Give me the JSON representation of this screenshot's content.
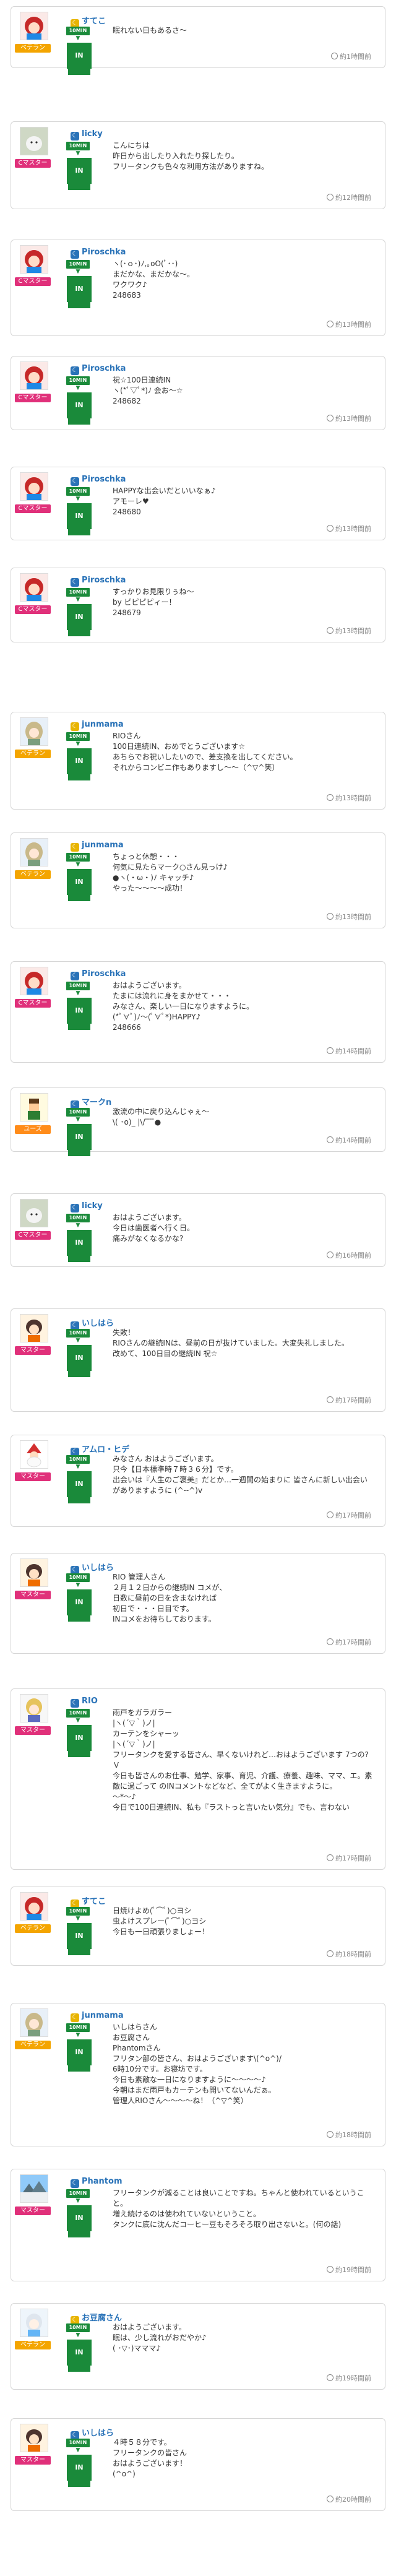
{
  "colors": {
    "veteran": "#f4a500",
    "master": "#e0307a",
    "novice": "#ff8c1a",
    "timein_green": "#1a8a3a",
    "name_blue": "#2a73b8"
  },
  "feed": [
    {
      "user": "すてこ",
      "badge": "ベテラン",
      "tag": "10MIN",
      "action": "IN",
      "message": "眠れない日もあるさ〜",
      "time": "約1時間前",
      "avatar": "red-hair-anime"
    },
    {
      "user": "licky",
      "badge": "Cマスター",
      "tag": "10MIN",
      "action": "IN",
      "message": "こんにちは\n昨日から出したり入れたり探したり。\nフリータンクも色々な利用方法がありますね。",
      "time": "約12時間前",
      "avatar": "white-dog"
    },
    {
      "user": "Piroschka",
      "badge": "Cマスター",
      "tag": "10MIN",
      "action": "IN",
      "message": "ヽ(･ｏ･)ﾉ,｡oO(ﾟ･･)\nまだかな、まだかな〜。\nワクワク♪\n248683",
      "time": "約13時間前",
      "avatar": "red-hair-anime"
    },
    {
      "user": "Piroschka",
      "badge": "Cマスター",
      "tag": "10MIN",
      "action": "IN",
      "message": "祝☆100日連続IN\nヽ(*ﾟ▽ﾟ*)ﾉ 会お〜☆\n248682",
      "time": "約13時間前",
      "avatar": "red-hair-anime"
    },
    {
      "user": "Piroschka",
      "badge": "Cマスター",
      "tag": "10MIN",
      "action": "IN",
      "message": "HAPPYな出会いだといいなぁ♪\nアモーレ♥\n248680",
      "time": "約13時間前",
      "avatar": "red-hair-anime"
    },
    {
      "user": "Piroschka",
      "badge": "Cマスター",
      "tag": "10MIN",
      "action": "IN",
      "message": "すっかりお見限りぅね〜\nby ピピピピィー！\n248679",
      "time": "約13時間前",
      "avatar": "red-hair-anime"
    },
    {
      "user": "junmama",
      "badge": "ベテラン",
      "tag": "10MIN",
      "action": "IN",
      "message": "RIOさん\n100日連続IN、おめでとうございます☆\nあちらでお祝いしたいので、差支換を出してください。\nそれからコンビニ作もありますし〜〜（^▽^笑）",
      "time": "約13時間前",
      "avatar": "anime-girl"
    },
    {
      "user": "junmama",
      "badge": "ベテラン",
      "tag": "10MIN",
      "action": "IN",
      "message": "ちょっと休憩・・・\n何気に見たらマーク○さん見っけ♪\n●ヽ(・ω・)ﾉ キャッチ♪\nやった〜〜〜〜成功！",
      "time": "約13時間前",
      "avatar": "anime-girl"
    },
    {
      "user": "Piroschka",
      "badge": "Cマスター",
      "tag": "10MIN",
      "action": "IN",
      "message": "おはようございます。\nたまには流れに身をまかせて・・・\nみなさん、楽しい一日になりますように。\n(*ﾟ∀ﾟ)ﾉ〜(ﾟ∀ﾟ*)HAPPY♪\n248666",
      "time": "約14時間前",
      "avatar": "red-hair-anime"
    },
    {
      "user": "マークn",
      "badge": "ユーズ",
      "tag": "10MIN",
      "action": "IN",
      "message": "激流の中に戻り込んじゃぇ〜\n\\( ･o)_ |\\/ ̄ ̄ ̄ ̄●",
      "time": "約14時間前",
      "avatar": "pixel-character"
    },
    {
      "user": "licky",
      "badge": "Cマスター",
      "tag": "10MIN",
      "action": "IN",
      "message": "おはようございます。\n今日は歯医者へ行く日。\n痛みがなくなるかな?",
      "time": "約16時間前",
      "avatar": "white-dog"
    },
    {
      "user": "いしはら",
      "badge": "マスター",
      "tag": "10MIN",
      "action": "IN",
      "message": "失敗！\nRIOさんの継続INは、昼前の日が抜けていました。大変失礼しました。\n改めて、100日目の継続IN 祝☆",
      "time": "約17時間前",
      "avatar": "anime-boy"
    },
    {
      "user": "アムロ・ヒデ",
      "badge": "マスター",
      "tag": "10MIN",
      "action": "IN",
      "message": "みなさん おはようございます。\n只今【日本標準時７時３６分】です。\n出会いは『人生のご褒美』だとか…一週間の始まりに 皆さんに新しい出会いがありますように (^--^)v",
      "time": "約17時間前",
      "avatar": "santa"
    },
    {
      "user": "いしはら",
      "badge": "マスター",
      "tag": "10MIN",
      "action": "IN",
      "message": "RIO 管理人さん\n２月１２日からの継続IN コメが、\n日数に昼前の日を含まなければ\n初日で・・・日目です。\nINコメをお待ちしております。",
      "time": "約17時間前",
      "avatar": "anime-boy"
    },
    {
      "user": "RIO",
      "badge": "マスター",
      "tag": "10MIN",
      "action": "IN",
      "message": "雨戸をガラガラー\n|ヽ(´▽｀)ノ|\nカーテンをシャーッ\n|ヽ(´▽｀)ノ|\nフリータンクを愛する皆さん、早くないけれど…おはようございます 7つの?Ｖ\n今日も皆さんのお仕事、勉学、家事、育児、介護、療養、趣味、ママ、エ。素敵に過ごって のINコメントなどなど、全てがよく生きますように。\n～*～♪\n今日で100日連続IN、私も『ラストっと言いたい気分』でも、言わない",
      "time": "約17時間前",
      "avatar": "anime-blonde"
    },
    {
      "user": "すてこ",
      "badge": "ベテラン",
      "tag": "10MIN",
      "action": "IN",
      "message": "日焼けよめ(ﾟ⌒ﾟ)○ヨシ\n虫よけスプレー(ﾟ⌒ﾟ)○ヨシ\n今日も一日頑張りましょー！",
      "time": "約18時間前",
      "avatar": "red-hair-anime"
    },
    {
      "user": "junmama",
      "badge": "ベテラン",
      "tag": "10MIN",
      "action": "IN",
      "message": "いしはらさん\nお豆腐さん\nPhantomさん\nフリタン部の皆さん、おはようございます\\(^o^)/\n6時10分です。お寝坊です。\n今日も素敵な一日になりますように〜〜〜〜♪\n今朝はまだ雨戸もカーテンも開いてないんだぁ。\n管理人RIOさん〜〜〜〜ね！（^▽^笑）",
      "time": "約18時間前",
      "avatar": "anime-girl"
    },
    {
      "user": "Phantom",
      "badge": "マスター",
      "tag": "10MIN",
      "action": "IN",
      "message": "フリータンクが減ることは良いことですね。ちゃんと使われているということ。\n増え続けるのは使われていないということ。\nタンクに底に沈んだコーヒー豆もそろそろ取り出さないと。(何の話)",
      "time": "約19時間前",
      "avatar": "winter-scene"
    },
    {
      "user": "お豆腐さん",
      "badge": "ベテラン",
      "tag": "10MIN",
      "action": "IN",
      "message": "おはようございます。\n眠は、少し流れがおだやか♪\n( ･▽･)マママ♪",
      "time": "約19時間前",
      "avatar": "anime-white"
    },
    {
      "user": "いしはら",
      "badge": "マスター",
      "tag": "10MIN",
      "action": "IN",
      "message": "４時５８分です。\nフリータンクの皆さん\nおはようございます！\n(^o^)",
      "time": "約20時間前",
      "avatar": "anime-boy"
    }
  ]
}
